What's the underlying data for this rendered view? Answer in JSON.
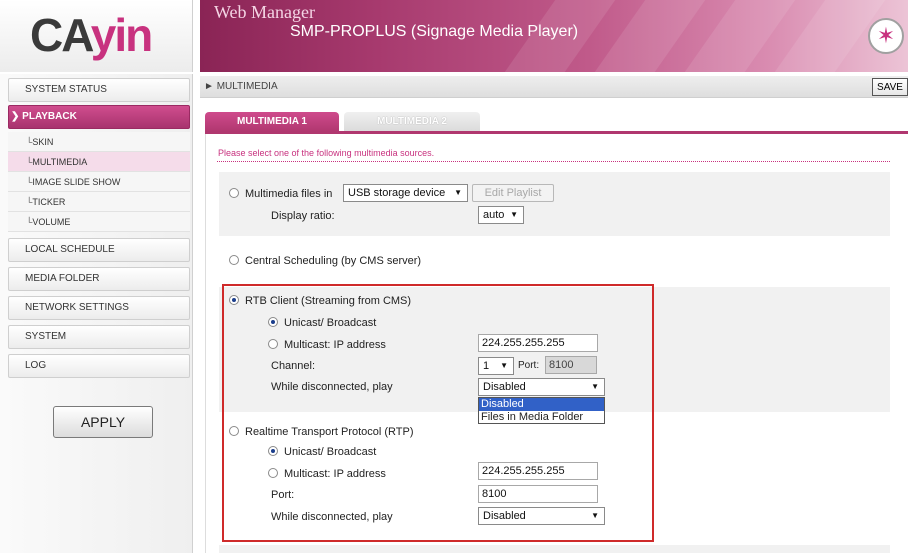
{
  "header": {
    "logo_left": "CA",
    "logo_right": "yin",
    "app_name": "Web Manager",
    "product": "SMP-PROPLUS (Signage Media Player)",
    "colors": {
      "brand": "#c8327f",
      "banner": "#a73a6e"
    }
  },
  "sidebar": {
    "items": [
      {
        "label": "SYSTEM STATUS"
      },
      {
        "label": "PLAYBACK"
      },
      {
        "label": "LOCAL SCHEDULE"
      },
      {
        "label": "MEDIA FOLDER"
      },
      {
        "label": "NETWORK SETTINGS"
      },
      {
        "label": "SYSTEM"
      },
      {
        "label": "LOG"
      }
    ],
    "sub_items": [
      {
        "label": "SKIN"
      },
      {
        "label": "MULTIMEDIA"
      },
      {
        "label": "IMAGE SLIDE SHOW"
      },
      {
        "label": "TICKER"
      },
      {
        "label": "VOLUME"
      }
    ],
    "apply_label": "APPLY"
  },
  "main": {
    "breadcrumb": "MULTIMEDIA",
    "save_label": "SAVE",
    "tabs": [
      {
        "label": "MULTIMEDIA 1"
      },
      {
        "label": "MULTIMEDIA 2"
      }
    ],
    "instruction": "Please select one of the following multimedia sources.",
    "multimedia_files": {
      "label": "Multimedia files in",
      "source_value": "USB storage device",
      "edit_playlist_label": "Edit Playlist",
      "display_ratio_label": "Display ratio:",
      "display_ratio_value": "auto"
    },
    "central_scheduling": {
      "label": "Central Scheduling (by CMS server)"
    },
    "rtb": {
      "label": "RTB Client (Streaming from CMS)",
      "unicast_label": "Unicast/ Broadcast",
      "multicast_label": "Multicast: IP address",
      "ip_value": "224.255.255.255",
      "channel_label": "Channel:",
      "channel_value": "1",
      "port_label": "Port:",
      "port_value": "8100",
      "disconnected_label": "While disconnected, play",
      "disconnected_value": "Disabled",
      "dropdown_options": [
        "Disabled",
        "Files in Media Folder"
      ]
    },
    "rtp": {
      "label": "Realtime Transport Protocol (RTP)",
      "unicast_label": "Unicast/ Broadcast",
      "multicast_label": "Multicast: IP address",
      "ip_value": "224.255.255.255",
      "port_label": "Port:",
      "port_value": "8100",
      "disconnected_label": "While disconnected, play",
      "disconnected_value": "Disabled"
    }
  }
}
